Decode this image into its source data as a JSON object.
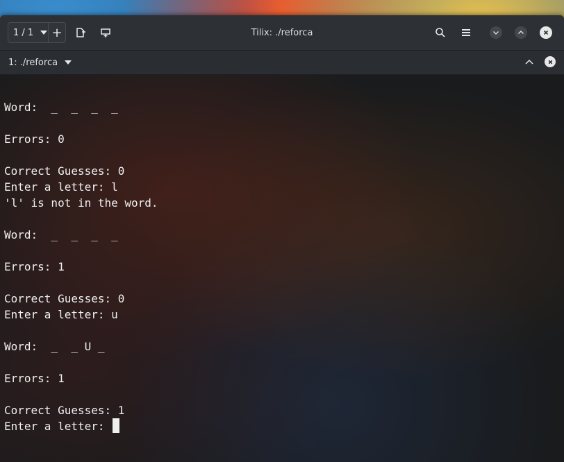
{
  "window": {
    "title": "Tilix: ./reforca"
  },
  "headerbar": {
    "session_count": "1 / 1",
    "icons": {
      "session_dropdown": "chevron-down-icon",
      "add_session": "plus-icon",
      "detach": "add-terminal-right-icon",
      "split": "add-terminal-down-icon",
      "search": "search-icon",
      "menu": "hamburger-menu-icon",
      "minimize": "chevron-down-icon",
      "maximize": "chevron-up-icon",
      "close": "close-icon"
    }
  },
  "tab": {
    "label": "1: ./reforca",
    "icons": {
      "dropdown": "chevron-down-icon",
      "maximize": "chevron-up-icon",
      "close": "close-icon"
    }
  },
  "terminal": {
    "lines": [
      "",
      "Word:  _  _  _  _",
      "",
      "Errors: 0",
      "",
      "Correct Guesses: 0",
      "Enter a letter: l",
      "'l' is not in the word.",
      "",
      "Word:  _  _  _  _",
      "",
      "Errors: 1",
      "",
      "Correct Guesses: 0",
      "Enter a letter: u",
      "",
      "Word:  _  _ U _",
      "",
      "Errors: 1",
      "",
      "Correct Guesses: 1",
      "Enter a letter: "
    ]
  },
  "colors": {
    "headerbar_bg": "#2d3135",
    "terminal_text": "#f0f0f0",
    "title_text": "#dcdcdc"
  }
}
